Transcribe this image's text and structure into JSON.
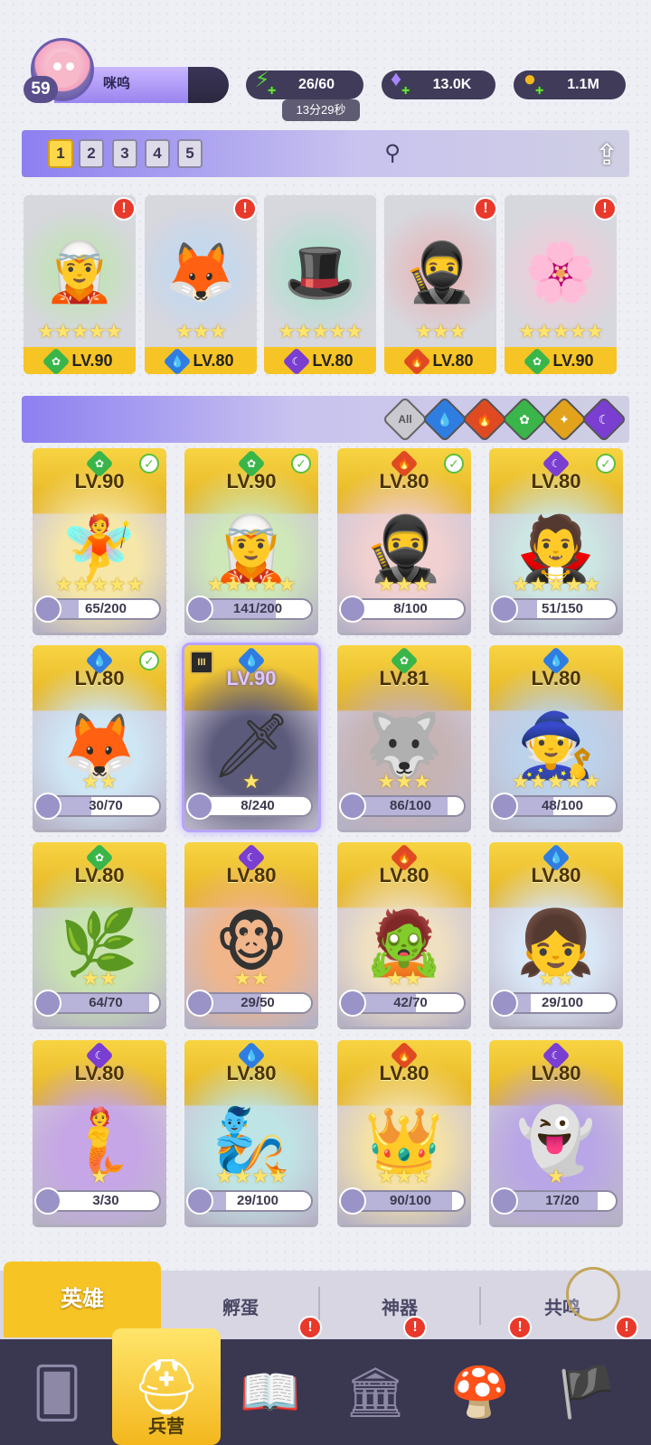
{
  "player": {
    "level": "59",
    "name": "咪呜"
  },
  "resources": {
    "stamina": "26/60",
    "stamina_timer": "13分29秒",
    "gems": "13.0K",
    "gold": "1.1M"
  },
  "team_tabs": [
    "1",
    "2",
    "3",
    "4",
    "5"
  ],
  "team": [
    {
      "level": "LV.90",
      "stars": "★★★★★",
      "element": "green"
    },
    {
      "level": "LV.80",
      "stars": "★★★",
      "element": "water"
    },
    {
      "level": "LV.80",
      "stars": "★★★★★",
      "element": "dark"
    },
    {
      "level": "LV.80",
      "stars": "★★★",
      "element": "fire"
    },
    {
      "level": "LV.90",
      "stars": "★★★★★",
      "element": "green"
    }
  ],
  "filters": {
    "all_label": "All"
  },
  "heroes": [
    {
      "level": "LV.90",
      "shards": "65/200",
      "progress": 0.325,
      "stars": "★★★★★",
      "element": "green",
      "deployed": true
    },
    {
      "level": "LV.90",
      "shards": "141/200",
      "progress": 0.705,
      "stars": "★★★★★",
      "element": "green",
      "deployed": true
    },
    {
      "level": "LV.80",
      "shards": "8/100",
      "progress": 0.08,
      "stars": "★★★",
      "element": "fire",
      "deployed": true
    },
    {
      "level": "LV.80",
      "shards": "51/150",
      "progress": 0.34,
      "stars": "★★★★★",
      "element": "dark",
      "deployed": true
    },
    {
      "level": "LV.80",
      "shards": "30/70",
      "progress": 0.43,
      "stars": "★★",
      "element": "water",
      "deployed": true
    },
    {
      "level": "LV.90",
      "shards": "8/240",
      "progress": 0.033,
      "stars": "★",
      "element": "water",
      "deployed": false,
      "rank": "III"
    },
    {
      "level": "LV.81",
      "shards": "86/100",
      "progress": 0.86,
      "stars": "★★★",
      "element": "green",
      "deployed": false
    },
    {
      "level": "LV.80",
      "shards": "48/100",
      "progress": 0.48,
      "stars": "★★★★★",
      "element": "water",
      "deployed": false
    },
    {
      "level": "LV.80",
      "shards": "64/70",
      "progress": 0.914,
      "stars": "★★",
      "element": "green",
      "deployed": false
    },
    {
      "level": "LV.80",
      "shards": "29/50",
      "progress": 0.58,
      "stars": "★★",
      "element": "dark",
      "deployed": false
    },
    {
      "level": "LV.80",
      "shards": "42/70",
      "progress": 0.6,
      "stars": "★★",
      "element": "fire",
      "deployed": false
    },
    {
      "level": "LV.80",
      "shards": "29/100",
      "progress": 0.29,
      "stars": "★★",
      "element": "water",
      "deployed": false
    },
    {
      "level": "LV.80",
      "shards": "3/30",
      "progress": 0.1,
      "stars": "★",
      "element": "dark",
      "deployed": false
    },
    {
      "level": "LV.80",
      "shards": "29/100",
      "progress": 0.29,
      "stars": "★★★★",
      "element": "water",
      "deployed": false
    },
    {
      "level": "LV.80",
      "shards": "90/100",
      "progress": 0.9,
      "stars": "★★★",
      "element": "fire",
      "deployed": false
    },
    {
      "level": "LV.80",
      "shards": "17/20",
      "progress": 0.85,
      "stars": "★",
      "element": "dark",
      "deployed": false
    }
  ],
  "subtabs": {
    "hero": "英雄",
    "hatch": "孵蛋",
    "artifact": "神器",
    "resonance": "共鸣"
  },
  "nav": {
    "barracks": "兵营"
  }
}
